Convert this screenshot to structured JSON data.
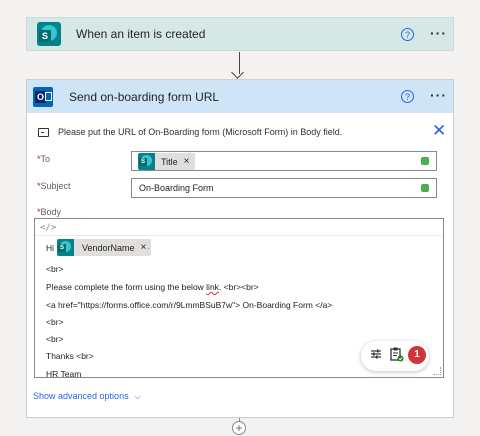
{
  "trigger": {
    "title": "When an item is created",
    "icon": "sharepoint-icon",
    "help_glyph": "?",
    "more_glyph": "···"
  },
  "action": {
    "title": "Send on-boarding form URL",
    "icon": "outlook-icon",
    "help_glyph": "?",
    "more_glyph": "···",
    "info_message": "Please put the URL of On-Boarding form (Microsoft Form) in Body field.",
    "close_glyph": "✕",
    "to": {
      "label": "To",
      "required_mark": "*",
      "token_label": "Title",
      "token_remove": "×"
    },
    "subject": {
      "label": "Subject",
      "required_mark": "*",
      "value": "On-Boarding Form"
    },
    "body": {
      "label": "Body",
      "required_mark": "*",
      "code_toggle": "</>",
      "hi_text": "Hi",
      "token_label": "VendorName",
      "token_remove": "×",
      "after_token": "·",
      "lines": {
        "l1": "<br>",
        "l2_before": "Please complete the form using the below ",
        "l2_link": "link",
        "l2_after": ". <br><br>",
        "l3": "<a href=\"https://forms.office.com/r/9LmmBSuB7w\"> On-Boarding Form </a>",
        "l4": "<br>",
        "l5": "<br>",
        "l6": "Thanks <br>",
        "l7": "HR Team"
      }
    },
    "floating_toolbar": {
      "badge_count": "1"
    },
    "advanced_label": "Show advanced options",
    "advanced_chevron": "⌵"
  },
  "add_step": "+",
  "colors": {
    "trigger_header": "#d5e8e6",
    "action_header": "#cfe4f6",
    "accent": "#2266e3",
    "error": "#d13438"
  }
}
